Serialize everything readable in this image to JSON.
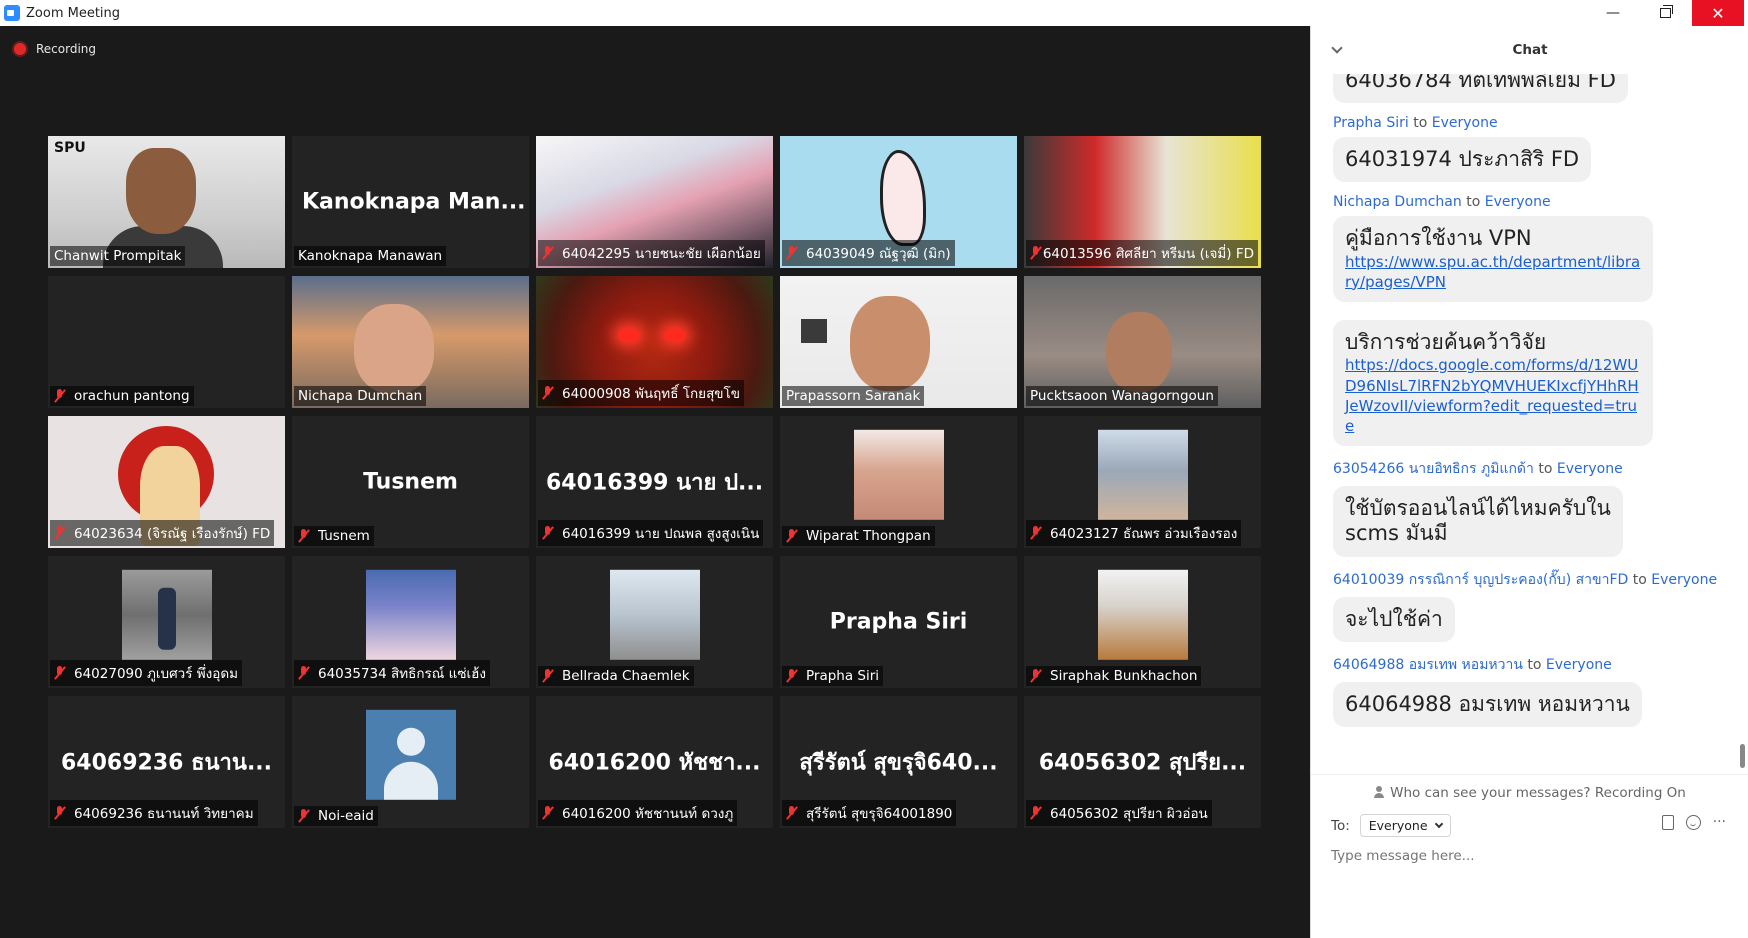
{
  "window": {
    "title": "Zoom Meeting",
    "minimize": "—",
    "close": "✕"
  },
  "recording": {
    "label": "Recording"
  },
  "participants": [
    {
      "name": "Chanwit Prompitak",
      "display": "",
      "muted": false,
      "active": true,
      "bg": "ph-teacher"
    },
    {
      "name": "Kanoknapa Manawan",
      "display": "Kanoknapa  Man...",
      "muted": false,
      "active": false,
      "bg": ""
    },
    {
      "name": "64042295 นายชนะชัย เผือกน้อย",
      "display": "",
      "muted": true,
      "active": false,
      "bg": "anime"
    },
    {
      "name": "64039049 ณัฐวุฒิ (มิก)",
      "display": "",
      "muted": true,
      "active": false,
      "bg": "sketch"
    },
    {
      "name": "64013596 ศิศลียา หรีมน (เจมี่) FD",
      "display": "",
      "muted": true,
      "active": false,
      "bg": "telly"
    },
    {
      "name": "orachun pantong",
      "display": "",
      "muted": true,
      "active": false,
      "bg": ""
    },
    {
      "name": "Nichapa Dumchan",
      "display": "",
      "muted": false,
      "active": false,
      "bg": "bridge"
    },
    {
      "name": "64000908 พันฤทธิ์ โกยสุขโข",
      "display": "",
      "muted": true,
      "active": false,
      "bg": "redface"
    },
    {
      "name": "Prapassorn Saranak",
      "display": "",
      "muted": false,
      "active": false,
      "bg": "lightroom"
    },
    {
      "name": "Pucktsaoon Wanagorngoun",
      "display": "",
      "muted": false,
      "active": false,
      "bg": "darkroom"
    },
    {
      "name": "64023634 (จิรณัฐ เรืองรักษ์) FD",
      "display": "",
      "muted": true,
      "active": false,
      "bg": "redcircle"
    },
    {
      "name": "Tusnem",
      "display": "Tusnem",
      "muted": true,
      "active": false,
      "bg": ""
    },
    {
      "name": "64016399 นาย ปณพล สูงสูงเนิน",
      "display": "64016399  นาย  ป...",
      "muted": true,
      "active": false,
      "bg": ""
    },
    {
      "name": "Wiparat Thongpan",
      "display": "",
      "muted": true,
      "active": false,
      "bg": "",
      "thumb": "t-girl"
    },
    {
      "name": "64023127 ธัณพร อ่วมเรืองรอง",
      "display": "",
      "muted": true,
      "active": false,
      "bg": "",
      "thumb": "t-room"
    },
    {
      "name": "64027090 ภูเบศวร์ พึ่งอุดม",
      "display": "",
      "muted": true,
      "active": false,
      "bg": "",
      "thumb": "t-street"
    },
    {
      "name": "64035734 สิทธิกรณ์ แซ่เฮ้ง",
      "display": "",
      "muted": true,
      "active": false,
      "bg": "",
      "thumb": "t-pink"
    },
    {
      "name": "Bellrada Chaemlek",
      "display": "",
      "muted": true,
      "active": false,
      "bg": "",
      "thumb": "t-city"
    },
    {
      "name": "Prapha Siri",
      "display": "Prapha  Siri",
      "muted": true,
      "active": false,
      "bg": ""
    },
    {
      "name": "Siraphak Bunkhachon",
      "display": "",
      "muted": true,
      "active": false,
      "bg": "",
      "thumb": "t-seal"
    },
    {
      "name": "64069236 ธนานนท์ วิทยาคม",
      "display": "64069236  ธนาน...",
      "muted": true,
      "active": false,
      "bg": ""
    },
    {
      "name": "Noi-eaid",
      "display": "",
      "muted": true,
      "active": false,
      "bg": "",
      "thumb": "t-avatar"
    },
    {
      "name": "64016200 หัชชานนท์ ดวงภู",
      "display": "64016200  หัชชา...",
      "muted": true,
      "active": false,
      "bg": ""
    },
    {
      "name": "สุรีรัตน์ สุขรุจิ64001890",
      "display": "สุรีรัตน์  สุขรุจิ640...",
      "muted": true,
      "active": false,
      "bg": ""
    },
    {
      "name": "64056302 สุปรียา ผิวอ่อน",
      "display": "64056302  สุปรีย...",
      "muted": true,
      "active": false,
      "bg": ""
    }
  ],
  "chat": {
    "title": "Chat",
    "messages": [
      {
        "sender": "",
        "to": "",
        "text": "64036784 ทิตเทพพลิเยิม FD",
        "links": [],
        "partial_top": true
      },
      {
        "sender": "Prapha Siri",
        "to": "Everyone",
        "text": "64031974 ประภาสิริ FD",
        "links": []
      },
      {
        "sender": "Nichapa Dumchan",
        "to": "Everyone",
        "text": "คู่มือการใช้งาน VPN",
        "links": [
          "https://www.spu.ac.th/department/library/pages/VPN"
        ]
      },
      {
        "sender": "",
        "to": "",
        "text": "บริการช่วยค้นคว้าวิจัย",
        "links": [
          "https://docs.google.com/forms/d/12WUD96NIsL7lRFN2bYQMVHUEKIxcfjYHhRHJeWzovII/viewform?edit_requested=true"
        ]
      },
      {
        "sender": "63054266 นายอิทธิกร ภูมิแกด้า",
        "to": "Everyone",
        "text": "ใช้บัตรออนไลน์ได้ไหมครับใน",
        "text2": "scms มันมี",
        "links": []
      },
      {
        "sender": "64010039 กรรณิการ์ บุญประคอง(กั๊บ) สาขาFD",
        "to": "Everyone",
        "text": "จะไปใช้ค่า",
        "links": []
      },
      {
        "sender": "64064988 อมรเทพ หอมหวาน",
        "to": "Everyone",
        "text": "64064988 อมรเทพ หอมหวาน",
        "links": []
      }
    ],
    "to_word": "to",
    "visibility_note": "Who can see your messages? Recording On",
    "to_label": "To:",
    "to_value": "Everyone",
    "more": "···",
    "input_placeholder": "Type message here..."
  }
}
